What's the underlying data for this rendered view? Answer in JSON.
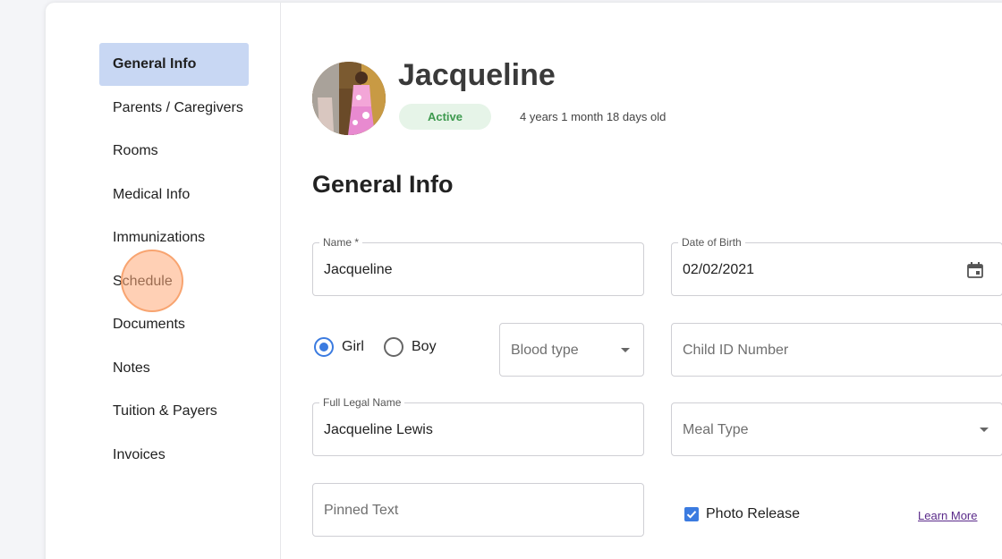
{
  "sidebar": {
    "items": [
      {
        "label": "General Info",
        "active": true
      },
      {
        "label": "Parents / Caregivers"
      },
      {
        "label": "Rooms"
      },
      {
        "label": "Medical Info"
      },
      {
        "label": "Immunizations"
      },
      {
        "label": "Schedule"
      },
      {
        "label": "Documents"
      },
      {
        "label": "Notes"
      },
      {
        "label": "Tuition & Payers"
      },
      {
        "label": "Invoices"
      }
    ]
  },
  "profile": {
    "name": "Jacqueline",
    "status": "Active",
    "age": "4 years 1 month 18 days old"
  },
  "section": {
    "title": "General Info"
  },
  "form": {
    "name": {
      "label": "Name *",
      "value": "Jacqueline"
    },
    "dob": {
      "label": "Date of Birth",
      "value": "02/02/2021"
    },
    "gender": {
      "options": [
        "Girl",
        "Boy"
      ],
      "selected": "Girl"
    },
    "blood_type": {
      "placeholder": "Blood type"
    },
    "child_id": {
      "placeholder": "Child ID Number"
    },
    "legal_name": {
      "label": "Full Legal Name",
      "value": "Jacqueline Lewis"
    },
    "meal_type": {
      "placeholder": "Meal Type"
    },
    "pinned_text": {
      "placeholder": "Pinned Text"
    },
    "photo_release": {
      "label": "Photo Release",
      "checked": true
    },
    "learn_more": "Learn More"
  },
  "colors": {
    "accent": "#3b7be0",
    "active_nav": "#c8d7f3",
    "status_bg": "#e6f4e8",
    "status_text": "#3e9a4f",
    "link": "#5a2a8a"
  },
  "icons": {
    "date_picker": "calendar-icon",
    "dropdown": "caret-down-icon",
    "checkbox": "check-icon"
  }
}
